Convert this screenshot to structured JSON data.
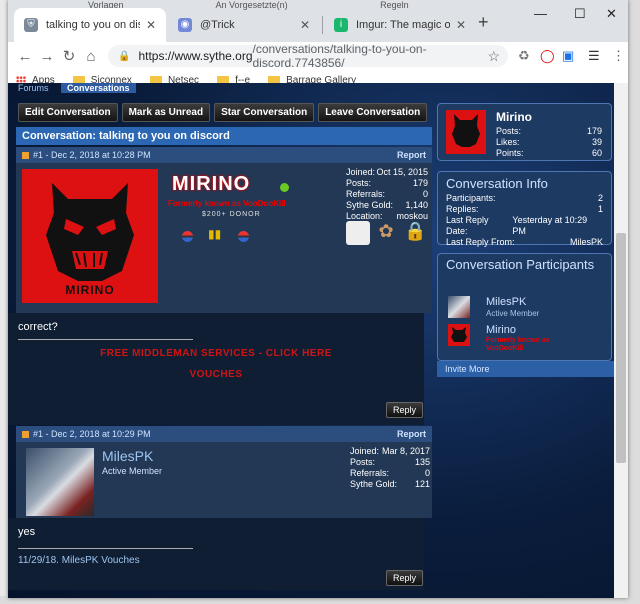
{
  "desktop": {
    "bg_tabs": [
      "Vorlagen",
      "An Vorgesetzte(n)",
      "Regeln"
    ]
  },
  "browser": {
    "tabs": [
      {
        "title": "talking to you on discord | Sy",
        "icon": "shield-icon",
        "active": true
      },
      {
        "title": "@Trick",
        "icon": "discord-icon",
        "active": false
      },
      {
        "title": "Imgur: The magic of the Inter",
        "icon": "imgur-icon",
        "active": false
      }
    ],
    "new_tab": "+",
    "window_controls": {
      "minimize": "—",
      "maximize": "☐",
      "close": "✕"
    },
    "url_host": "https://www.sythe.org",
    "url_path": "/conversations/talking-to-you-on-discord.7743856/",
    "bookmarks": [
      {
        "label": "Apps",
        "icon": "apps-grid-icon"
      },
      {
        "label": "Siconnex",
        "icon": "folder-icon"
      },
      {
        "label": "Netsec",
        "icon": "folder-icon"
      },
      {
        "label": "f--e",
        "icon": "folder-icon"
      },
      {
        "label": "Barrage Gallery",
        "icon": "folder-icon"
      }
    ]
  },
  "page": {
    "breadcrumb": [
      "Forums",
      "Conversations"
    ],
    "actions": [
      "Edit Conversation",
      "Mark as Unread",
      "Star Conversation",
      "Leave Conversation"
    ],
    "conversation_title": "Conversation: talking to you on discord",
    "posts": [
      {
        "num_date": "#1 - Dec 2, 2018 at 10:28 PM",
        "report": "Report",
        "username": "MIRINO",
        "formerly": "Formerly known as VooDooKill",
        "donor": "$200+ DONOR",
        "avatar_text": "MIRINO",
        "stats": [
          {
            "k": "Joined:",
            "v": "Oct 15, 2015"
          },
          {
            "k": "Posts:",
            "v": "179"
          },
          {
            "k": "Referrals:",
            "v": "0"
          },
          {
            "k": "Sythe Gold:",
            "v": "1,140"
          },
          {
            "k": "Location:",
            "v": "moskou"
          }
        ],
        "body": "correct?",
        "sig_links": [
          "FREE MIDDLEMAN SERVICES - CLICK HERE",
          "VOUCHES"
        ],
        "reply": "Reply"
      },
      {
        "num_date": "#1 - Dec 2, 2018 at 10:29 PM",
        "report": "Report",
        "username": "MilesPK",
        "rank": "Active Member",
        "stats": [
          {
            "k": "Joined:",
            "v": "Mar 8, 2017"
          },
          {
            "k": "Posts:",
            "v": "135"
          },
          {
            "k": "Referrals:",
            "v": "0"
          },
          {
            "k": "Sythe Gold:",
            "v": "121"
          }
        ],
        "body": "yes",
        "sig_prefix": "11/29/18.",
        "sig_link": "MilesPK Vouches",
        "reply": "Reply"
      }
    ],
    "profile": {
      "name": "Mirino",
      "avatar_text": "MIRINO",
      "rows": [
        {
          "k": "Posts:",
          "v": "179"
        },
        {
          "k": "Likes:",
          "v": "39"
        },
        {
          "k": "Points:",
          "v": "60"
        }
      ]
    },
    "conversation_info": {
      "title": "Conversation Info",
      "rows": [
        {
          "k": "Participants:",
          "v": "2"
        },
        {
          "k": "Replies:",
          "v": "1"
        },
        {
          "k": "Last Reply Date:",
          "v": "Yesterday at 10:29 PM"
        },
        {
          "k": "Last Reply From:",
          "v": "MilesPK"
        }
      ]
    },
    "participants": {
      "title": "Conversation Participants",
      "list": [
        {
          "name": "MilesPK",
          "sub": "Active Member"
        },
        {
          "name": "Mirino",
          "sub": "Formerly known as VooDooKill"
        }
      ],
      "invite": "Invite More"
    }
  },
  "colors": {
    "accent_blue": "#2b67b3",
    "danger_red": "#d01414",
    "online_green": "#6ac925"
  }
}
